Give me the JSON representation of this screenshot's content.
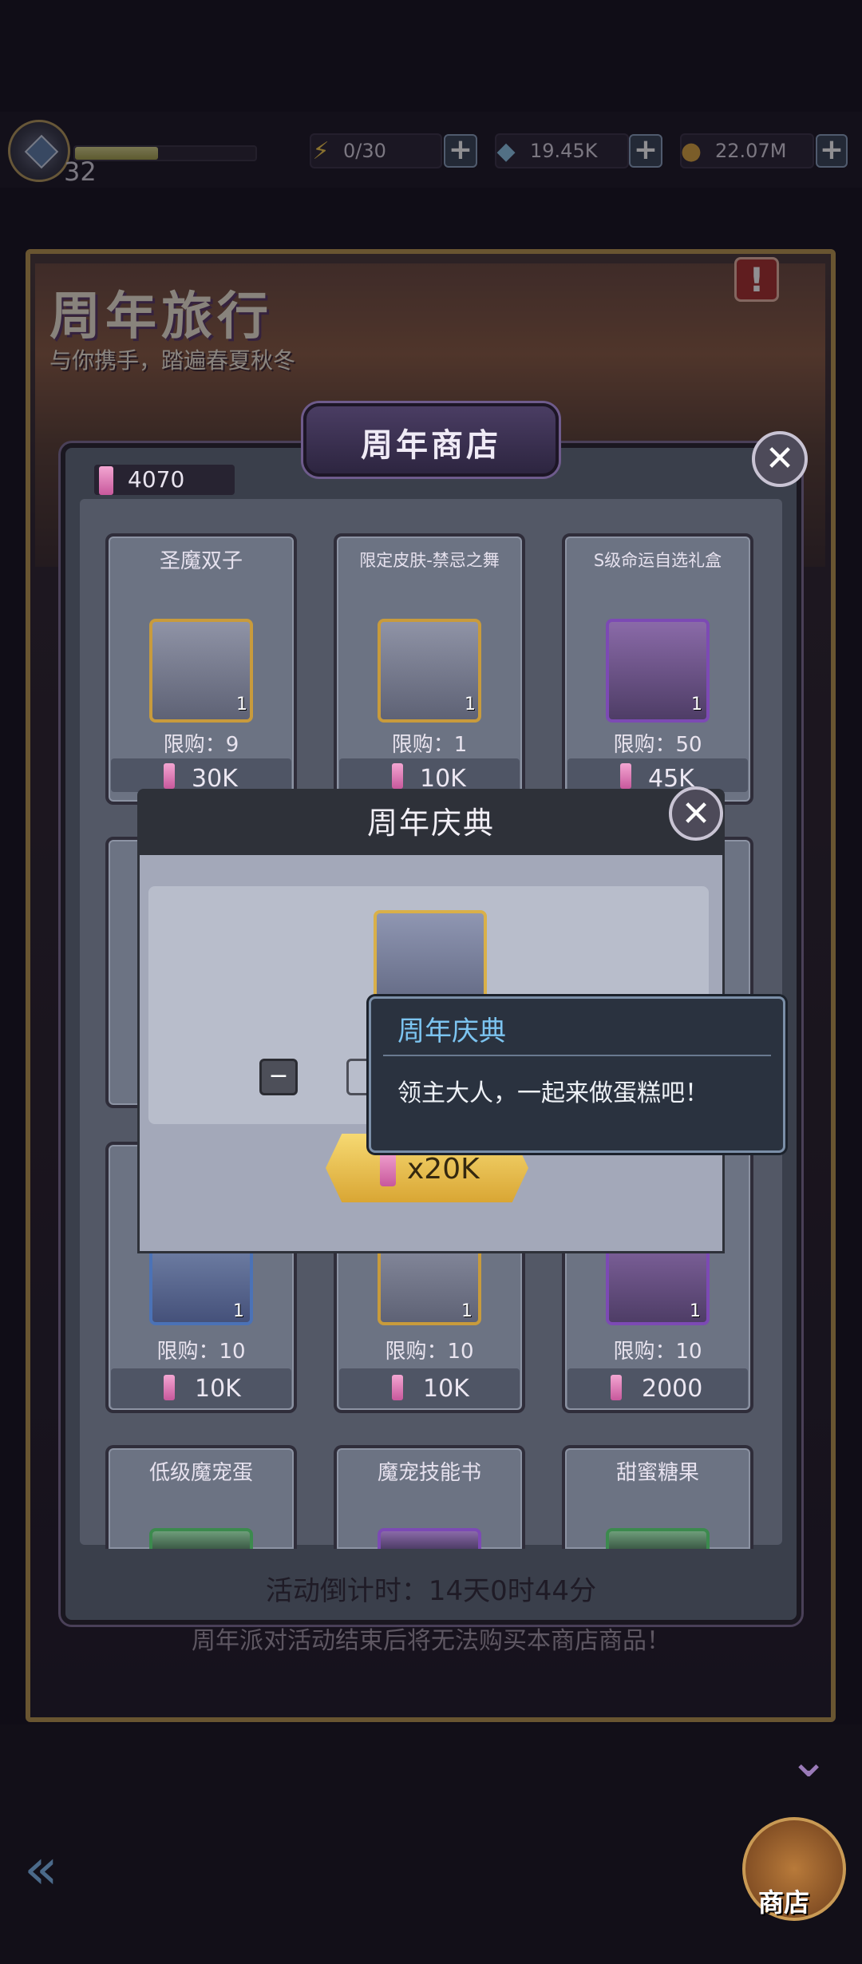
{
  "status_bar": {
    "player_level": "32",
    "stamina": "0/30",
    "diamonds": "19.45K",
    "gold": "22.07M",
    "plus_label": "+"
  },
  "event": {
    "title": "周年旅行",
    "subtitle": "与你携手，踏遍春夏秋冬",
    "alert_label": "!",
    "bottom_notice": "周年派对活动结束后将无法购买本商店商品！"
  },
  "shop": {
    "title": "周年商店",
    "currency_amount": "4070",
    "close_label": "✕",
    "countdown": "活动倒计时：14天0时44分",
    "row1": [
      {
        "name": "圣魔双子",
        "qty": "1",
        "limit": "限购：9",
        "price": "30K"
      },
      {
        "name": "限定皮肤-禁忌之舞",
        "qty": "1",
        "limit": "限购：1",
        "price": "10K"
      },
      {
        "name": "S级命运自选礼盒",
        "qty": "1",
        "limit": "限购：50",
        "price": "45K"
      }
    ],
    "row3": [
      {
        "qty": "1",
        "limit": "限购：10",
        "price": "10K"
      },
      {
        "qty": "1",
        "limit": "限购：10",
        "price": "10K"
      },
      {
        "qty": "1",
        "limit": "限购：10",
        "price": "2000"
      }
    ],
    "row4": [
      {
        "name": "低级魔宠蛋"
      },
      {
        "name": "魔宠技能书"
      },
      {
        "name": "甜蜜糖果"
      }
    ]
  },
  "dialog": {
    "title": "周年庆典",
    "close_label": "✕",
    "minus_label": "−",
    "price": "x20K"
  },
  "tooltip": {
    "title": "周年庆典",
    "description": "领主大人，一起来做蛋糕吧！"
  },
  "nav": {
    "shop_label": "商店"
  }
}
